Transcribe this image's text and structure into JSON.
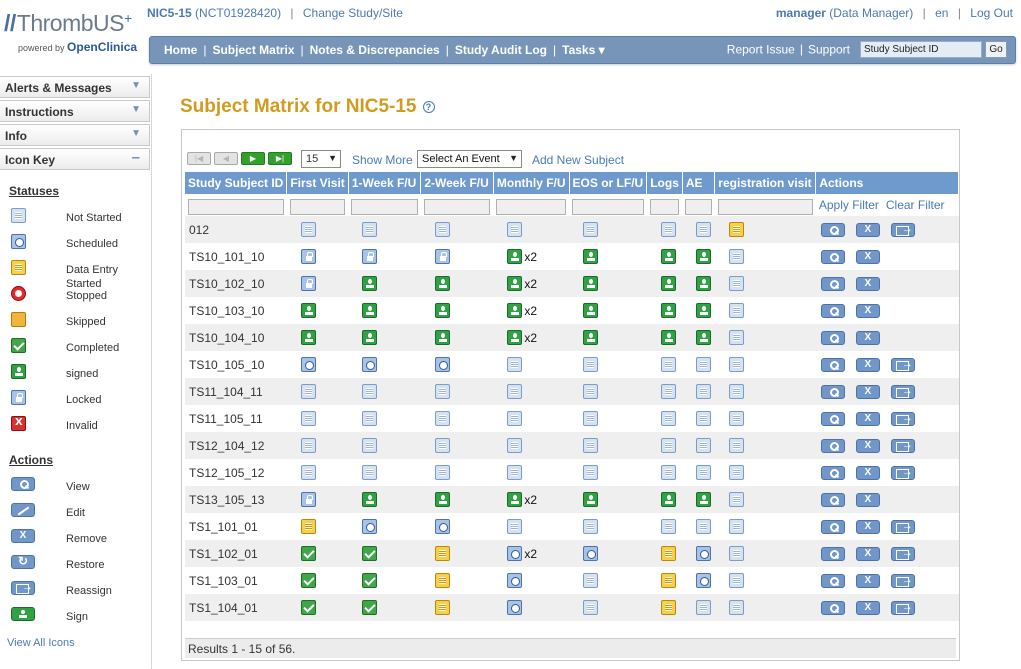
{
  "header": {
    "logo_text": "ThrombUS",
    "logo_plus": "+",
    "powered_by": "powered by",
    "openclinica_open": "Open",
    "openclinica_clinica": "Clinica",
    "study_name": "NIC5-15",
    "study_id": "(NCT01928420)",
    "change_study": "Change Study/Site",
    "username": "manager",
    "role": "(Data Manager)",
    "language": "en",
    "logout": "Log Out"
  },
  "nav": {
    "home": "Home",
    "subject_matrix": "Subject Matrix",
    "notes": "Notes & Discrepancies",
    "audit_log": "Study Audit Log",
    "tasks": "Tasks ▾",
    "report_issue": "Report Issue",
    "support": "Support",
    "search_value": "Study Subject ID",
    "go": "Go"
  },
  "sidebar": {
    "panels": [
      "Alerts & Messages",
      "Instructions",
      "Info",
      "Icon Key"
    ],
    "statuses_title": "Statuses",
    "statuses": [
      {
        "icon": "not_started",
        "label": "Not Started"
      },
      {
        "icon": "scheduled",
        "label": "Scheduled"
      },
      {
        "icon": "data_entry_started",
        "label": "Data Entry Started"
      },
      {
        "icon": "stopped",
        "label": "Stopped"
      },
      {
        "icon": "skipped",
        "label": "Skipped"
      },
      {
        "icon": "completed",
        "label": "Completed"
      },
      {
        "icon": "signed",
        "label": "signed"
      },
      {
        "icon": "locked",
        "label": "Locked"
      },
      {
        "icon": "invalid",
        "label": "Invalid"
      }
    ],
    "actions_title": "Actions",
    "actions": [
      {
        "icon": "view",
        "label": "View"
      },
      {
        "icon": "edit",
        "label": "Edit"
      },
      {
        "icon": "remove",
        "label": "Remove"
      },
      {
        "icon": "restore",
        "label": "Restore"
      },
      {
        "icon": "reassign",
        "label": "Reassign"
      },
      {
        "icon": "sign",
        "label": "Sign"
      }
    ],
    "view_all": "View All Icons"
  },
  "main": {
    "title": "Subject Matrix for NIC5-15",
    "help": "?",
    "page_size": "15",
    "show_more": "Show More",
    "event_select": "Select An Event",
    "add_subject": "Add New Subject",
    "apply_filter": "Apply Filter",
    "clear_filter": "Clear Filter",
    "results": "Results 1 - 15 of 56."
  },
  "table": {
    "columns": [
      "Study Subject ID",
      "First Visit",
      "1-Week F/U",
      "2-Week F/U",
      "Monthly F/U",
      "EOS or LF/U",
      "Logs",
      "AE",
      "registration visit",
      "Actions"
    ],
    "rows": [
      {
        "id": "012",
        "cells": [
          "not_started",
          "not_started",
          "not_started",
          "not_started",
          "not_started",
          "not_started",
          "not_started",
          "data_entry_started"
        ],
        "counts": [
          "",
          "",
          "",
          "",
          "",
          "",
          "",
          ""
        ],
        "actions": [
          "view",
          "remove",
          "reassign"
        ]
      },
      {
        "id": "TS10_101_10",
        "cells": [
          "locked",
          "locked",
          "locked",
          "signed",
          "signed",
          "signed",
          "signed",
          "not_started"
        ],
        "counts": [
          "",
          "",
          "",
          "x2",
          "",
          "",
          "",
          ""
        ],
        "actions": [
          "view",
          "remove"
        ]
      },
      {
        "id": "TS10_102_10",
        "cells": [
          "locked",
          "signed",
          "signed",
          "signed",
          "signed",
          "signed",
          "signed",
          "not_started"
        ],
        "counts": [
          "",
          "",
          "",
          "x2",
          "",
          "",
          "",
          ""
        ],
        "actions": [
          "view",
          "remove"
        ]
      },
      {
        "id": "TS10_103_10",
        "cells": [
          "signed",
          "signed",
          "signed",
          "signed",
          "signed",
          "signed",
          "signed",
          "not_started"
        ],
        "counts": [
          "",
          "",
          "",
          "x2",
          "",
          "",
          "",
          ""
        ],
        "actions": [
          "view",
          "remove"
        ]
      },
      {
        "id": "TS10_104_10",
        "cells": [
          "signed",
          "signed",
          "signed",
          "signed",
          "signed",
          "signed",
          "signed",
          "not_started"
        ],
        "counts": [
          "",
          "",
          "",
          "x2",
          "",
          "",
          "",
          ""
        ],
        "actions": [
          "view",
          "remove"
        ]
      },
      {
        "id": "TS10_105_10",
        "cells": [
          "scheduled",
          "scheduled",
          "scheduled",
          "not_started",
          "not_started",
          "not_started",
          "not_started",
          "not_started"
        ],
        "counts": [
          "",
          "",
          "",
          "",
          "",
          "",
          "",
          ""
        ],
        "actions": [
          "view",
          "remove",
          "reassign"
        ]
      },
      {
        "id": "TS11_104_11",
        "cells": [
          "not_started",
          "not_started",
          "not_started",
          "not_started",
          "not_started",
          "not_started",
          "not_started",
          "not_started"
        ],
        "counts": [
          "",
          "",
          "",
          "",
          "",
          "",
          "",
          ""
        ],
        "actions": [
          "view",
          "remove",
          "reassign"
        ]
      },
      {
        "id": "TS11_105_11",
        "cells": [
          "not_started",
          "not_started",
          "not_started",
          "not_started",
          "not_started",
          "not_started",
          "not_started",
          "not_started"
        ],
        "counts": [
          "",
          "",
          "",
          "",
          "",
          "",
          "",
          ""
        ],
        "actions": [
          "view",
          "remove",
          "reassign"
        ]
      },
      {
        "id": "TS12_104_12",
        "cells": [
          "not_started",
          "not_started",
          "not_started",
          "not_started",
          "not_started",
          "not_started",
          "not_started",
          "not_started"
        ],
        "counts": [
          "",
          "",
          "",
          "",
          "",
          "",
          "",
          ""
        ],
        "actions": [
          "view",
          "remove",
          "reassign"
        ]
      },
      {
        "id": "TS12_105_12",
        "cells": [
          "not_started",
          "not_started",
          "not_started",
          "not_started",
          "not_started",
          "not_started",
          "not_started",
          "not_started"
        ],
        "counts": [
          "",
          "",
          "",
          "",
          "",
          "",
          "",
          ""
        ],
        "actions": [
          "view",
          "remove",
          "reassign"
        ]
      },
      {
        "id": "TS13_105_13",
        "cells": [
          "locked",
          "signed",
          "signed",
          "signed",
          "signed",
          "signed",
          "signed",
          "not_started"
        ],
        "counts": [
          "",
          "",
          "",
          "x2",
          "",
          "",
          "",
          ""
        ],
        "actions": [
          "view",
          "remove"
        ]
      },
      {
        "id": "TS1_101_01",
        "cells": [
          "data_entry_started",
          "scheduled",
          "scheduled",
          "not_started",
          "not_started",
          "not_started",
          "not_started",
          "not_started"
        ],
        "counts": [
          "",
          "",
          "",
          "",
          "",
          "",
          "",
          ""
        ],
        "actions": [
          "view",
          "remove",
          "reassign"
        ]
      },
      {
        "id": "TS1_102_01",
        "cells": [
          "completed",
          "completed",
          "data_entry_started",
          "scheduled",
          "scheduled",
          "data_entry_started",
          "scheduled",
          "not_started"
        ],
        "counts": [
          "",
          "",
          "",
          "x2",
          "",
          "",
          "",
          ""
        ],
        "actions": [
          "view",
          "remove",
          "reassign"
        ]
      },
      {
        "id": "TS1_103_01",
        "cells": [
          "completed",
          "completed",
          "data_entry_started",
          "scheduled",
          "not_started",
          "data_entry_started",
          "scheduled",
          "not_started"
        ],
        "counts": [
          "",
          "",
          "",
          "",
          "",
          "",
          "",
          ""
        ],
        "actions": [
          "view",
          "remove",
          "reassign"
        ]
      },
      {
        "id": "TS1_104_01",
        "cells": [
          "completed",
          "completed",
          "data_entry_started",
          "scheduled",
          "not_started",
          "data_entry_started",
          "not_started",
          "not_started"
        ],
        "counts": [
          "",
          "",
          "",
          "",
          "",
          "",
          "",
          ""
        ],
        "actions": [
          "view",
          "remove",
          "reassign"
        ]
      }
    ]
  },
  "colors": {
    "nav_bg": "#7795b8",
    "title_gold": "#d09b1e",
    "table_header": "#6f9acd",
    "link_blue": "#4a7ab5"
  }
}
